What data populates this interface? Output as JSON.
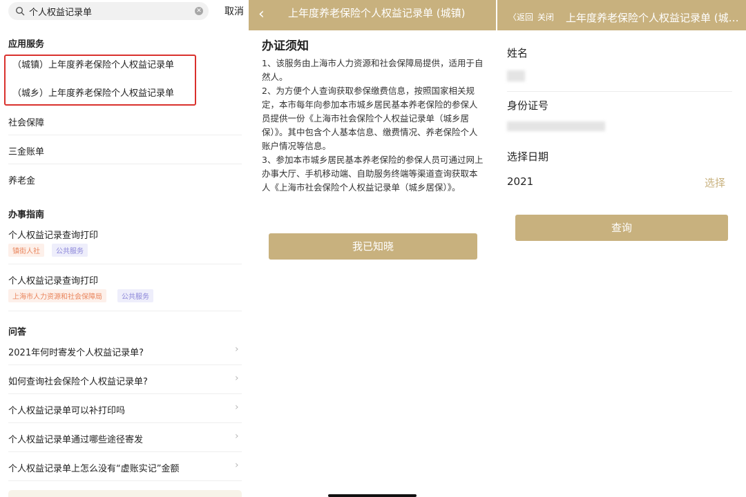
{
  "colors": {
    "gold": "#c8b17e",
    "highlight": "#d9302c",
    "tag_orange": "#e9855c",
    "tag_purple": "#8b86d9"
  },
  "search_screen": {
    "search_value": "个人权益记录单",
    "cancel_label": "取消",
    "app_section_title": "应用服务",
    "app_items": [
      "（城镇）上年度养老保险个人权益记录单",
      "（城乡）上年度养老保险个人权益记录单"
    ],
    "categories": [
      "社会保障",
      "三金账单",
      "养老金"
    ],
    "guide_section_title": "办事指南",
    "guides": [
      {
        "title": "个人权益记录查询打印",
        "tags": [
          "镇街人社",
          "公共服务"
        ]
      },
      {
        "title": "个人权益记录查询打印",
        "tags": [
          "上海市人力资源和社会保障局",
          "公共服务"
        ]
      }
    ],
    "qa_section_title": "问答",
    "questions": [
      "2021年何时寄发个人权益记录单?",
      "如何查询社会保险个人权益记录单?",
      "个人权益记录单可以补打印吗",
      "个人权益记录单通过哪些途径寄发",
      "个人权益记录单上怎么没有“虚账实记”金额"
    ]
  },
  "notice_screen": {
    "title": "上年度养老保险个人权益记录单 (城镇)",
    "heading": "办证须知",
    "paragraphs": [
      "1、该服务由上海市人力资源和社会保障局提供，适用于自然人。",
      "2、为方便个人查询获取参保缴费信息，按照国家相关规定，本市每年向参加本市城乡居民基本养老保险的参保人员提供一份《上海市社会保险个人权益记录单（城乡居保）》。其中包含个人基本信息、缴费情况、养老保险个人账户情况等信息。",
      "3、参加本市城乡居民基本养老保险的参保人员可通过网上办事大厅、手机移动端、自助服务终端等渠道查询获取本人《上海市社会保险个人权益记录单（城乡居保）》。"
    ],
    "confirm_label": "我已知晓"
  },
  "query_screen": {
    "back_label": "〈返回",
    "close_label": "关闭",
    "title": "上年度养老保险个人权益记录单 (城镇)",
    "name_label": "姓名",
    "id_label": "身份证号",
    "date_label": "选择日期",
    "year_value": "2021",
    "select_label": "选择",
    "query_label": "查询"
  }
}
